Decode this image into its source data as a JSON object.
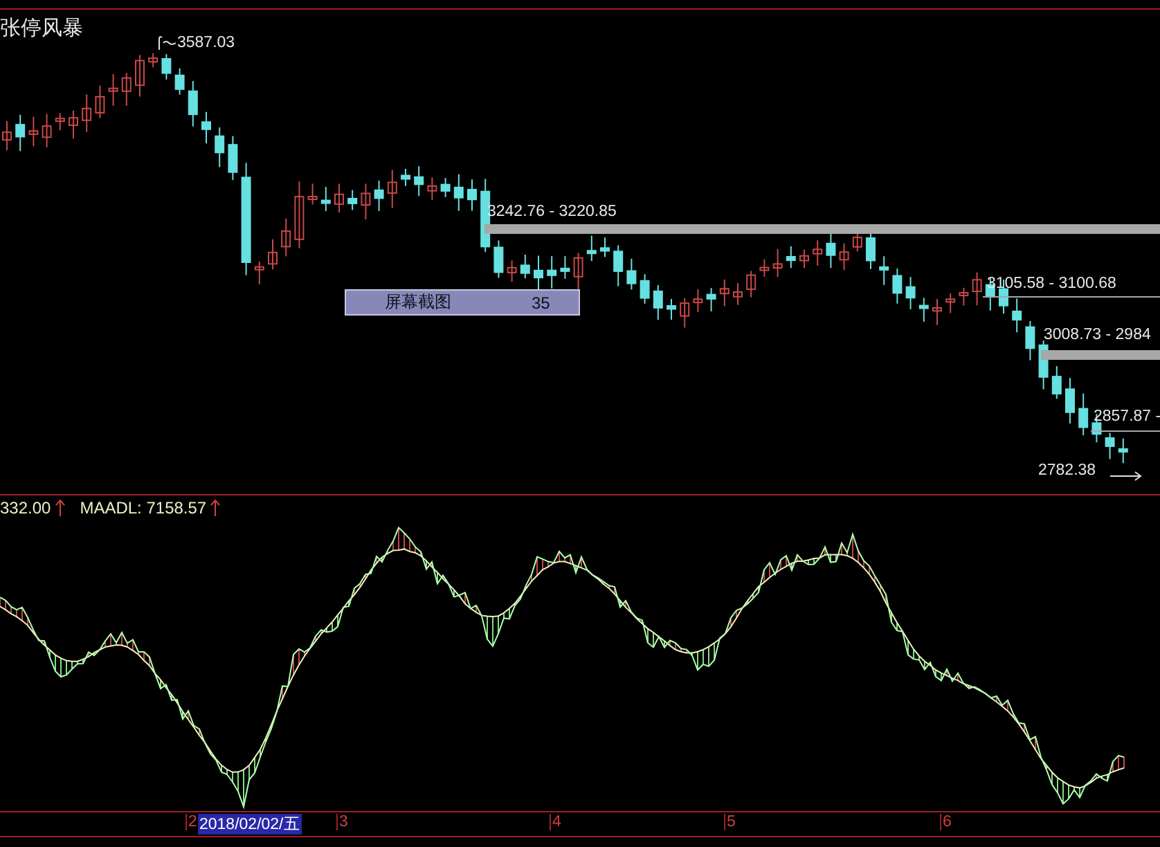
{
  "chart_title": "张停风暴",
  "price_labels": [
    {
      "kind": "peak",
      "text": "3587.03"
    },
    {
      "kind": "band",
      "text": "3242.76 - 3220.85"
    },
    {
      "kind": "line",
      "text": "3105.58 - 3100.68"
    },
    {
      "kind": "band",
      "text": "3008.73 - 2984"
    },
    {
      "kind": "line",
      "text": "2857.87 -"
    },
    {
      "kind": "low",
      "text": "2782.38"
    }
  ],
  "tooltip": {
    "label": "屏幕截图",
    "value": "35"
  },
  "indicator": {
    "readings": [
      {
        "text": "332.00"
      },
      {
        "text": "MAADL: 7158.57"
      }
    ]
  },
  "time_axis": {
    "marks": [
      {
        "text": "2",
        "selected": false
      },
      {
        "text": "2018/02/02/五",
        "selected": true
      },
      {
        "text": "3",
        "selected": false
      },
      {
        "text": "4",
        "selected": false
      },
      {
        "text": "5",
        "selected": false
      },
      {
        "text": "6",
        "selected": false
      }
    ]
  }
}
